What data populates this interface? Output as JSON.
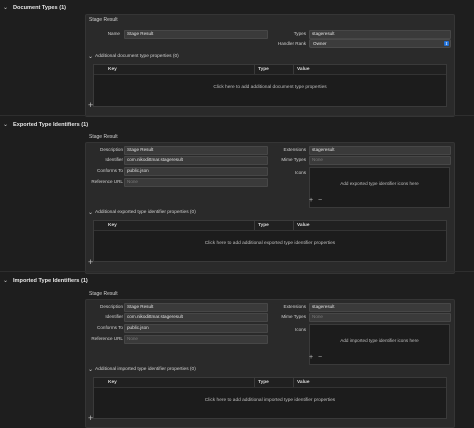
{
  "document_types": {
    "section_title": "Document Types (1)",
    "panel_title": "Stage Result",
    "name_label": "Name",
    "name_value": "Stage Result",
    "types_label": "Types",
    "types_value": "stageresult",
    "handler_rank_label": "Handler Rank",
    "handler_rank_value": "Owner",
    "additional_title": "Additional document type properties (0)",
    "col_key": "Key",
    "col_type": "Type",
    "col_value": "Value",
    "empty_msg": "Click here to add additional document type properties"
  },
  "exported": {
    "section_title": "Exported Type Identifiers (1)",
    "panel_title": "Stage Result",
    "description_label": "Description",
    "description_value": "Stage Result",
    "identifier_label": "Identifier",
    "identifier_value": "com.nikodittmar.stageresult",
    "conforms_label": "Conforms To",
    "conforms_value": "public.json",
    "reference_label": "Reference URL",
    "reference_placeholder": "None",
    "extensions_label": "Extensions",
    "extensions_value": "stageresult",
    "mime_label": "Mime Types",
    "mime_placeholder": "None",
    "icons_label": "Icons",
    "icons_msg": "Add exported type identifier icons here",
    "additional_title": "Additional exported type identifier properties (0)",
    "col_key": "Key",
    "col_type": "Type",
    "col_value": "Value",
    "empty_msg": "Click here to add additional exported type identifier properties"
  },
  "imported": {
    "section_title": "Imported Type Identifiers (1)",
    "panel_title": "Stage Result",
    "description_label": "Description",
    "description_value": "Stage Result",
    "identifier_label": "Identifier",
    "identifier_value": "com.nikodittmar.stageresult",
    "conforms_label": "Conforms To",
    "conforms_value": "public.json",
    "reference_label": "Reference URL",
    "reference_placeholder": "None",
    "extensions_label": "Extensions",
    "extensions_value": "stageresult",
    "mime_label": "Mime Types",
    "mime_placeholder": "None",
    "icons_label": "Icons",
    "icons_msg": "Add imported type identifier icons here",
    "additional_title": "Additional imported type identifier properties (0)",
    "col_key": "Key",
    "col_type": "Type",
    "col_value": "Value",
    "empty_msg": "Click here to add additional imported type identifier properties"
  },
  "glyphs": {
    "chevron": "⌄",
    "plus": "+",
    "minus": "−",
    "up_down": "⇕"
  },
  "colors": {
    "background": "#1e1e1e",
    "accent": "#1f6fd6"
  }
}
